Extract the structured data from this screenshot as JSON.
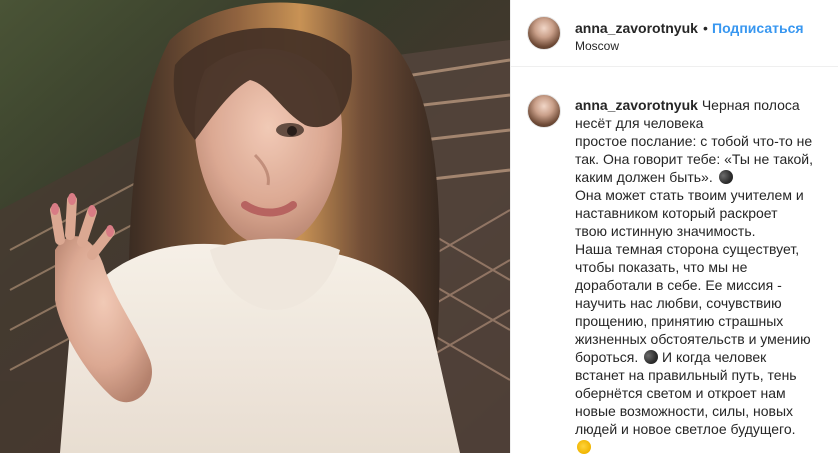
{
  "post": {
    "username": "anna_zavorotnyuk",
    "separator": "•",
    "subscribe_label": "Подписаться",
    "location": "Moscow"
  },
  "caption": {
    "username": "anna_zavorotnyuk",
    "lines": [
      "Черная полоса",
      "несёт для человека",
      "простое послание: с тобой что-то не",
      "так. Она говорит тебе: «Ты не такой,",
      "каким должен быть».",
      "Она может стать твоим учителем и",
      "наставником который раскроет",
      "твою истинную значимость.",
      "Наша темная сторона существует,",
      "чтобы показать, что мы не",
      "доработали в себе. Ее миссия -",
      "научить нас любви, сочувствию",
      "прощению, принятию страшных",
      "жизненных обстоятельств и умению",
      "бороться.",
      "И когда человек",
      "встанет на правильный путь, тень",
      "обернётся светом и откроет нам",
      "новые возможности, силы, новых",
      "людей и новое светлое будущего."
    ]
  },
  "icons": {
    "emoji_1": "new-moon-face-emoji",
    "emoji_2": "moon-phase-emoji",
    "emoji_3": "sun-emoji"
  },
  "colors": {
    "link": "#3897f0",
    "text": "#262626",
    "border": "#efefef"
  }
}
